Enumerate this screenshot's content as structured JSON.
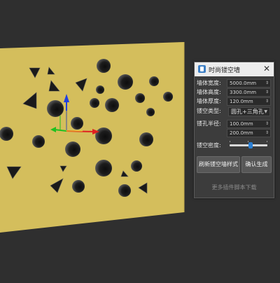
{
  "panel": {
    "title": "时尚镂空墙",
    "close_glyph": "✕",
    "fields": [
      {
        "label": "墙体宽度:",
        "value": "5000.0mm"
      },
      {
        "label": "墙体高度:",
        "value": "3300.0mm"
      },
      {
        "label": "墙体厚度:",
        "value": "120.0mm"
      }
    ],
    "hollow_type": {
      "label": "镂空类型:",
      "value": "圆孔+三角孔"
    },
    "radius": {
      "label": "镂孔半径:",
      "min": "100.0mm",
      "max": "200.0mm"
    },
    "density": {
      "label": "镂空密度:",
      "level": 0.55
    },
    "buttons": {
      "refresh": "刷新镂空墙样式",
      "confirm": "确认生成"
    },
    "more_link": "更多插件脚本下载",
    "spinner_arrows": "⇕",
    "dropdown_arrow": "▼"
  },
  "viewport": {
    "wall_color": "#d4be5c",
    "background": "#2f2f2f",
    "gizmo_colors": {
      "x": "#e02020",
      "y": "#20c020",
      "z": "#2040e0",
      "center": "#f0d020"
    }
  }
}
